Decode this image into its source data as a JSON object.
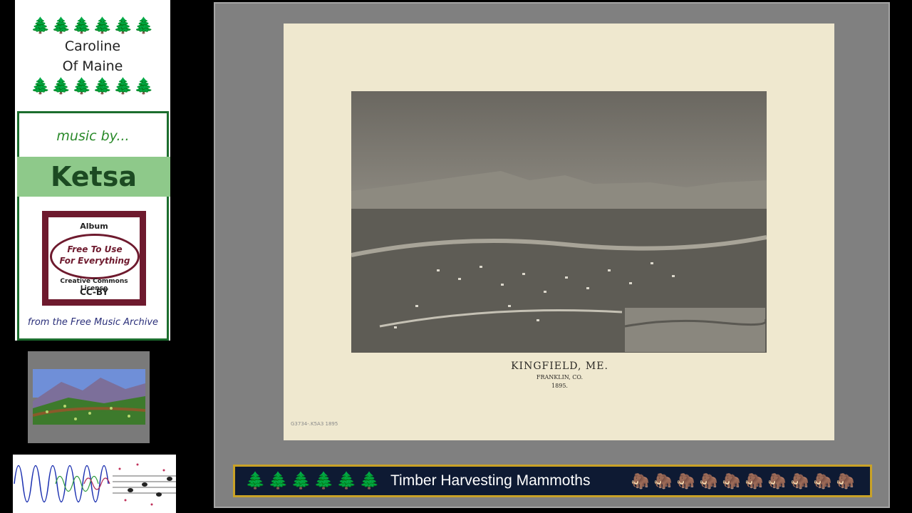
{
  "sidebar": {
    "tree_icon": "evergreen-tree-icon",
    "tree_glyph": "🌲",
    "trees_per_row": 6,
    "artist_line1": "Caroline",
    "artist_line2": "Of Maine",
    "music_by": "music by...",
    "musician": "Ketsa",
    "album_label": "Album",
    "album_title_line1": "Free To Use",
    "album_title_line2": "For Everything",
    "license_label": "Creative Commons License",
    "license_code": "CC-BY",
    "source_credit": "from the Free Music Archive",
    "colors": {
      "tree_green": "#1e8a3a",
      "box_border": "#1c6e2e",
      "band_green": "#8ec98a",
      "album_border": "#6e1a2e"
    }
  },
  "viewer": {
    "map": {
      "title": "KINGFIELD, ME.",
      "subtitle": "FRANKLIN, CO.",
      "year": "1895.",
      "call_number": "G3734-.K5A3 1895"
    },
    "title_bar": {
      "track_title": "Timber Harvesting Mammoths",
      "tree_glyph": "🌲",
      "tree_count": 6,
      "mammoth_glyph": "🦣",
      "mammoth_icon": "mammoth-icon",
      "mammoth_count": 10,
      "colors": {
        "background": "#0e1a33",
        "border": "#c9a227",
        "text": "#ffffff"
      }
    }
  }
}
